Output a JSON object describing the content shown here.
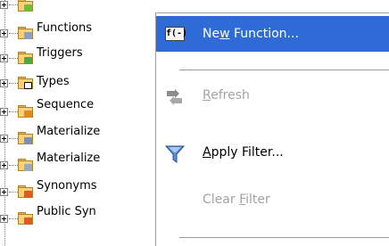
{
  "tree": {
    "items": [
      {
        "label": "",
        "icon": "folder-green-icon",
        "badge_color": "#6fbe3a"
      },
      {
        "label": "Functions",
        "icon": "functions-folder-icon",
        "badge_color": "#8aa0c8"
      },
      {
        "label": "Triggers",
        "icon": "triggers-folder-icon",
        "badge_color": "#4caa3c"
      },
      {
        "label": "Types",
        "icon": "types-folder-icon",
        "badge_color": "#ffffff"
      },
      {
        "label": "Sequence",
        "icon": "sequences-folder-icon",
        "badge_color": "#e08a1e"
      },
      {
        "label": "Materialize",
        "icon": "materialized-views-folder-icon",
        "badge_color": "#7d8fb8"
      },
      {
        "label": "Materialize",
        "icon": "materialized-view-logs-folder-icon",
        "badge_color": "#9aa8c0"
      },
      {
        "label": "Synonyms",
        "icon": "synonyms-folder-icon",
        "badge_color": "#e05a20"
      },
      {
        "label": "Public Syn",
        "icon": "public-synonyms-folder-icon",
        "badge_color": "#e05a20"
      }
    ]
  },
  "context_menu": {
    "new_function": {
      "prefix": "Ne",
      "mnemonic": "w",
      "suffix": " Function...",
      "icon_text": "f(-)",
      "icon": "new-function-icon"
    },
    "refresh": {
      "prefix": "",
      "mnemonic": "R",
      "suffix": "efresh",
      "icon": "refresh-icon"
    },
    "apply_filter": {
      "prefix": "",
      "mnemonic": "A",
      "suffix": "pply Filter...",
      "icon": "filter-funnel-icon"
    },
    "clear_filter": {
      "prefix": "Clear ",
      "mnemonic": "F",
      "suffix": "ilter"
    }
  },
  "colors": {
    "highlight": "#2f6bd6",
    "disabled_text": "#a3a3a3"
  }
}
